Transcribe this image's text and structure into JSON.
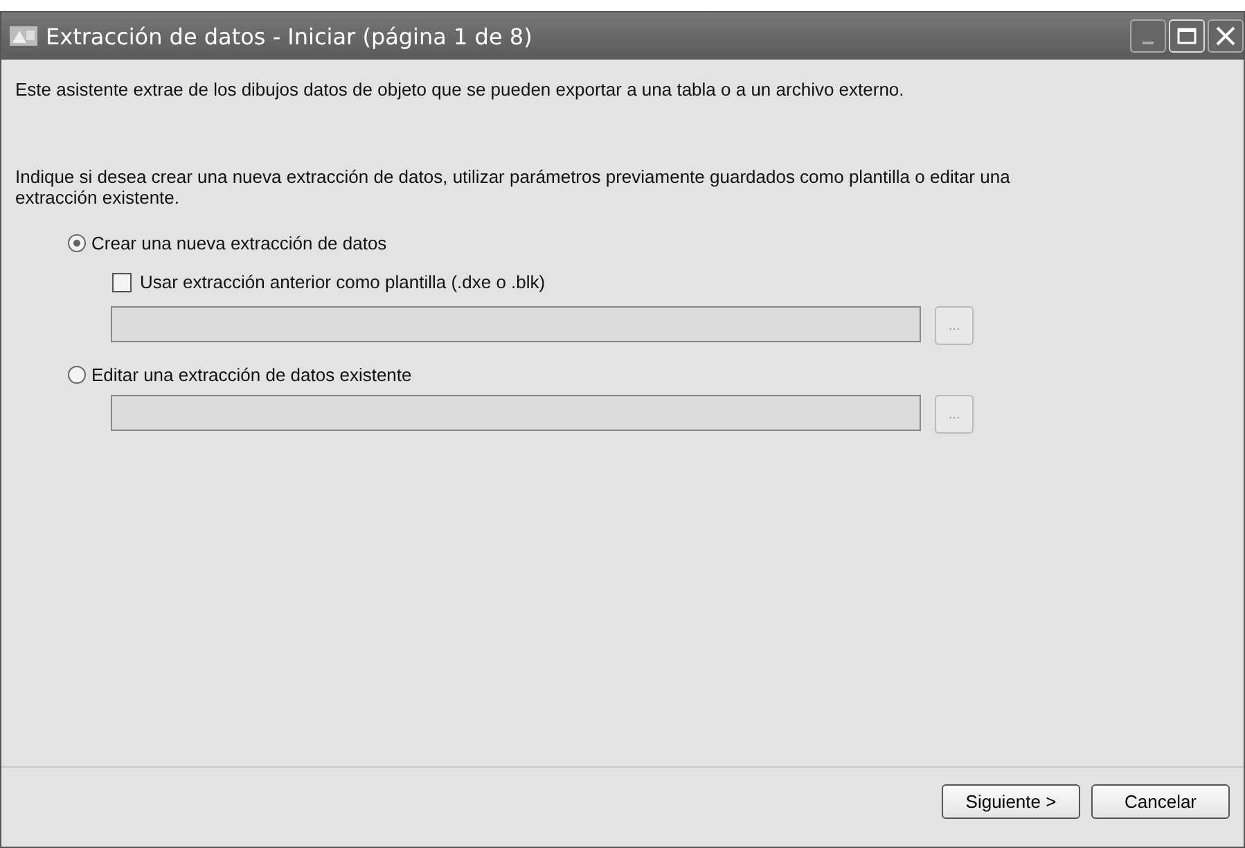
{
  "window": {
    "title": "Extracción de datos - Iniciar (página 1 de 8)"
  },
  "intro": "Este asistente extrae de los dibujos datos de objeto que se pueden exportar a una tabla o a un archivo externo.",
  "prompt": "Indique si desea crear una nueva extracción de datos, utilizar parámetros previamente guardados como plantilla o editar una extracción existente.",
  "options": [
    {
      "label": "Crear una nueva extracción de datos",
      "selected": true,
      "template": {
        "label": "Usar extracción anterior como plantilla (.dxe o .blk)",
        "checked": false
      },
      "field": {
        "disabled": true
      },
      "browse": {
        "label": "...",
        "disabled": true
      }
    },
    {
      "label": "Editar una extracción de datos existente",
      "selected": false,
      "field": {
        "disabled": true
      },
      "browse": {
        "label": "...",
        "disabled": true
      }
    }
  ],
  "buttons": [
    {
      "label": "Siguiente >"
    },
    {
      "label": "Cancelar"
    }
  ]
}
